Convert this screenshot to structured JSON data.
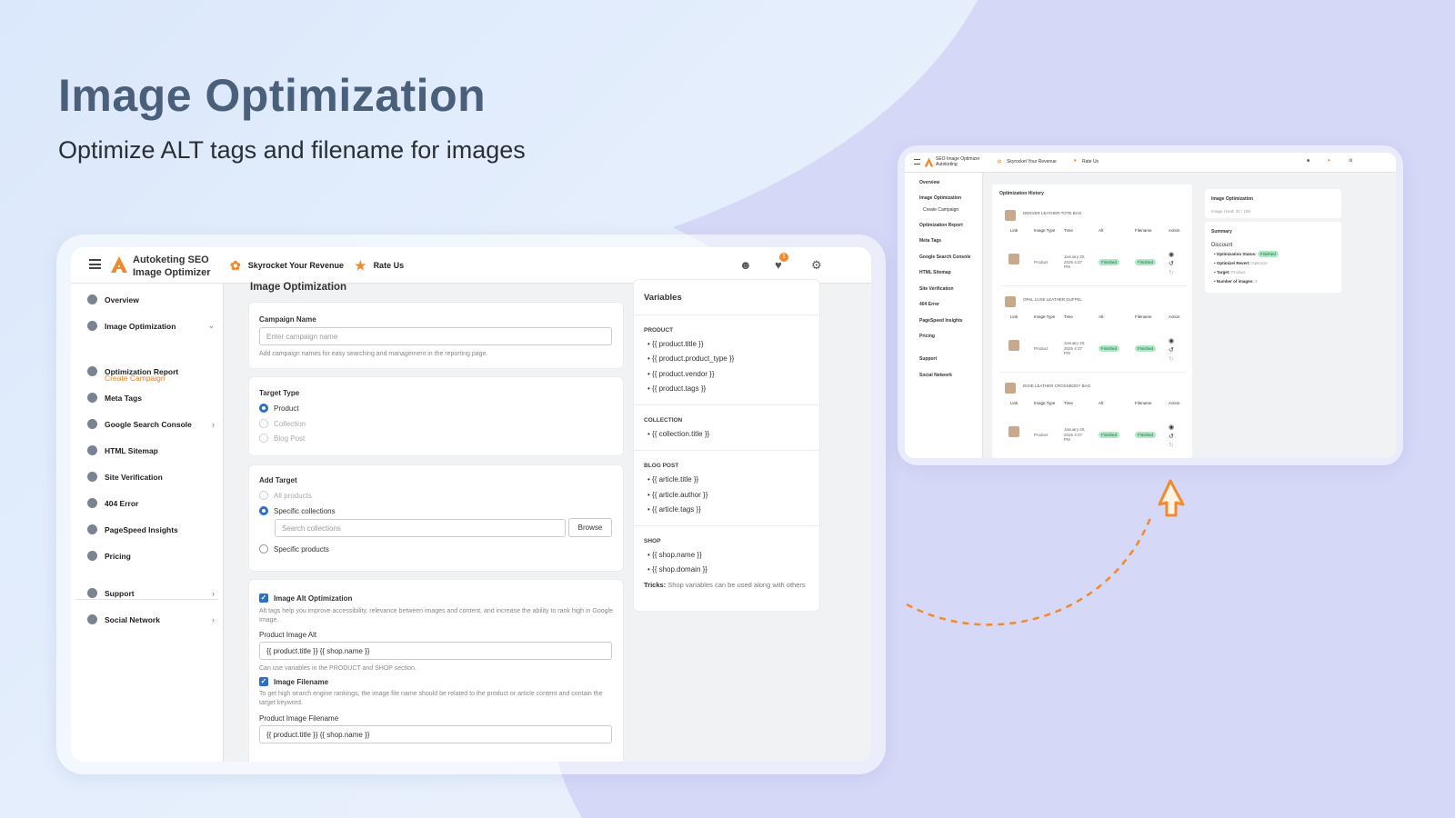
{
  "hero": {
    "title": "Image Optimization",
    "subtitle": "Optimize ALT tags and filename for images"
  },
  "colors": {
    "accent": "#f08a2c",
    "primary": "#2c6ecb",
    "success_bg": "#aee9c6"
  },
  "app": {
    "brand_line1": "Autoketing SEO",
    "brand_line2": "Image Optimizer",
    "topbar": {
      "skyrocket": "Skyrocket Your Revenue",
      "rate": "Rate Us",
      "notification_count": "1"
    },
    "sidebar": {
      "overview": "Overview",
      "image_optimization": "Image Optimization",
      "create_campaign": "Create Campaign",
      "optimization_report": "Optimization Report",
      "meta_tags": "Meta Tags",
      "google_search_console": "Google Search Console",
      "html_sitemap": "HTML Sitemap",
      "site_verification": "Site Verification",
      "error_404": "404 Error",
      "pagespeed": "PageSpeed Insights",
      "pricing": "Pricing",
      "support": "Support",
      "social_network": "Social Network"
    },
    "page_title": "Image Optimization",
    "campaign": {
      "label": "Campaign Name",
      "placeholder": "Enter campaign name",
      "help": "Add campaign names for easy searching and management in the reporting page."
    },
    "target_type": {
      "label": "Target Type",
      "options": [
        "Product",
        "Collection",
        "Blog Post"
      ]
    },
    "add_target": {
      "label": "Add Target",
      "all_products": "All products",
      "specific_collections": "Specific collections",
      "search_placeholder": "Search collections",
      "browse": "Browse",
      "specific_products": "Specific products"
    },
    "alt": {
      "label": "Image Alt Optimization",
      "help": "Alt tags help you improve accessibility, relevance between images and content, and increase the ability to rank high in Google Image.",
      "field_label": "Product Image Alt",
      "value": "{{ product.title }} {{ shop.name }}",
      "field_help": "Can use variables in the PRODUCT and SHOP section."
    },
    "filename": {
      "label": "Image Filename",
      "help": "To get high search engine rankings, the image file name should be related to the product or article content and contain the target keyword.",
      "field_label": "Product Image Filename",
      "value": "{{ product.title }} {{ shop.name }}"
    },
    "variables": {
      "title": "Variables",
      "product_heading": "PRODUCT",
      "product": [
        "{{ product.title }}",
        "{{ product.product_type }}",
        "{{ product.vendor }}",
        "{{ product.tags }}"
      ],
      "collection_heading": "COLLECTION",
      "collection": [
        "{{ collection.title }}"
      ],
      "blog_heading": "BLOG POST",
      "blog": [
        "{{ article.title }}",
        "{{ article.author }}",
        "{{ article.tags }}"
      ],
      "shop_heading": "SHOP",
      "shop": [
        "{{ shop.name }}",
        "{{ shop.domain }}"
      ],
      "tricks_label": "Tricks:",
      "tricks": "Shop variables can be used along with others"
    }
  },
  "app2": {
    "brand_line1": "SEO Image Optimizer",
    "brand_line2": "Autoketing",
    "skyrocket": "Skyrocket Your Revenue",
    "rate": "Rate Us",
    "sidebar": [
      "Overview",
      "Image Optimization",
      "Create Campaign",
      "Optimization Report",
      "Meta Tags",
      "Google Search Console",
      "HTML Sitemap",
      "Site Verification",
      "404 Error",
      "PageSpeed Insights",
      "Pricing",
      "Support",
      "Social Network"
    ],
    "history_title": "Optimization History",
    "columns": [
      "Link",
      "Image Type",
      "Time",
      "Alt",
      "Filename",
      "Action"
    ],
    "rows": [
      {
        "name": "DENVER LEATHER TOTE BAG",
        "type": "Product",
        "time": "January 20, 2025 4:37 PM",
        "alt": "Finished",
        "filename": "Finished"
      },
      {
        "name": "OPAL LUXE LEATHER DUFFEL",
        "type": "Product",
        "time": "January 20, 2025 4:37 PM",
        "alt": "Finished",
        "filename": "Finished"
      },
      {
        "name": "DIXIE LEATHER CROSSBODY BAG",
        "type": "Product",
        "time": "January 20, 2025 4:37 PM",
        "alt": "Finished",
        "filename": "Finished"
      }
    ],
    "side_card_title": "Image Optimization",
    "image_used": "Image Used: 32 / 100",
    "summary_title": "Summary",
    "summary_name": "Discount",
    "summary_items": [
      {
        "label": "Optimization Status:",
        "value": "Finished"
      },
      {
        "label": "Optimize/ Revert:",
        "value": "Optimize"
      },
      {
        "label": "Target:",
        "value": "Product"
      },
      {
        "label": "Number of images:",
        "value": "3"
      }
    ]
  }
}
